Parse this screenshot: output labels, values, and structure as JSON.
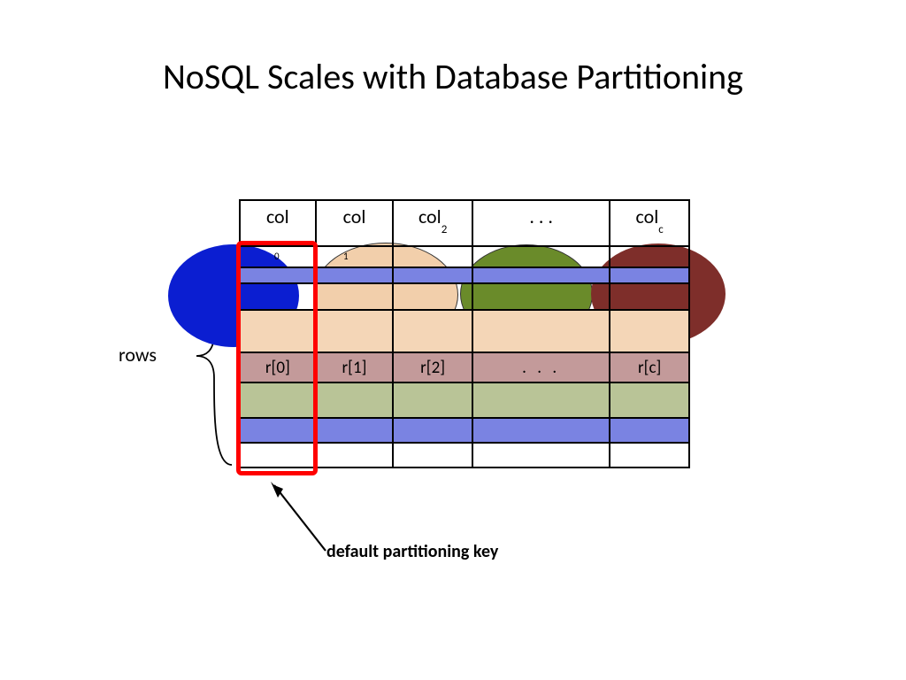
{
  "title": "NoSQL Scales with Database Partitioning",
  "headers": {
    "c0": "col",
    "c1": "col",
    "c2": "col",
    "c2_sub": "2",
    "c3": ". . .",
    "c4": "col",
    "c4_sub": "c"
  },
  "sub0": "0",
  "sub1": "1",
  "row_cells": {
    "r0": "r[0]",
    "r1": "r[1]",
    "r2": "r[2]",
    "r3": ". . .",
    "r4": "r[c]"
  },
  "labels": {
    "rows": "rows",
    "arrow": "default partitioning key"
  }
}
